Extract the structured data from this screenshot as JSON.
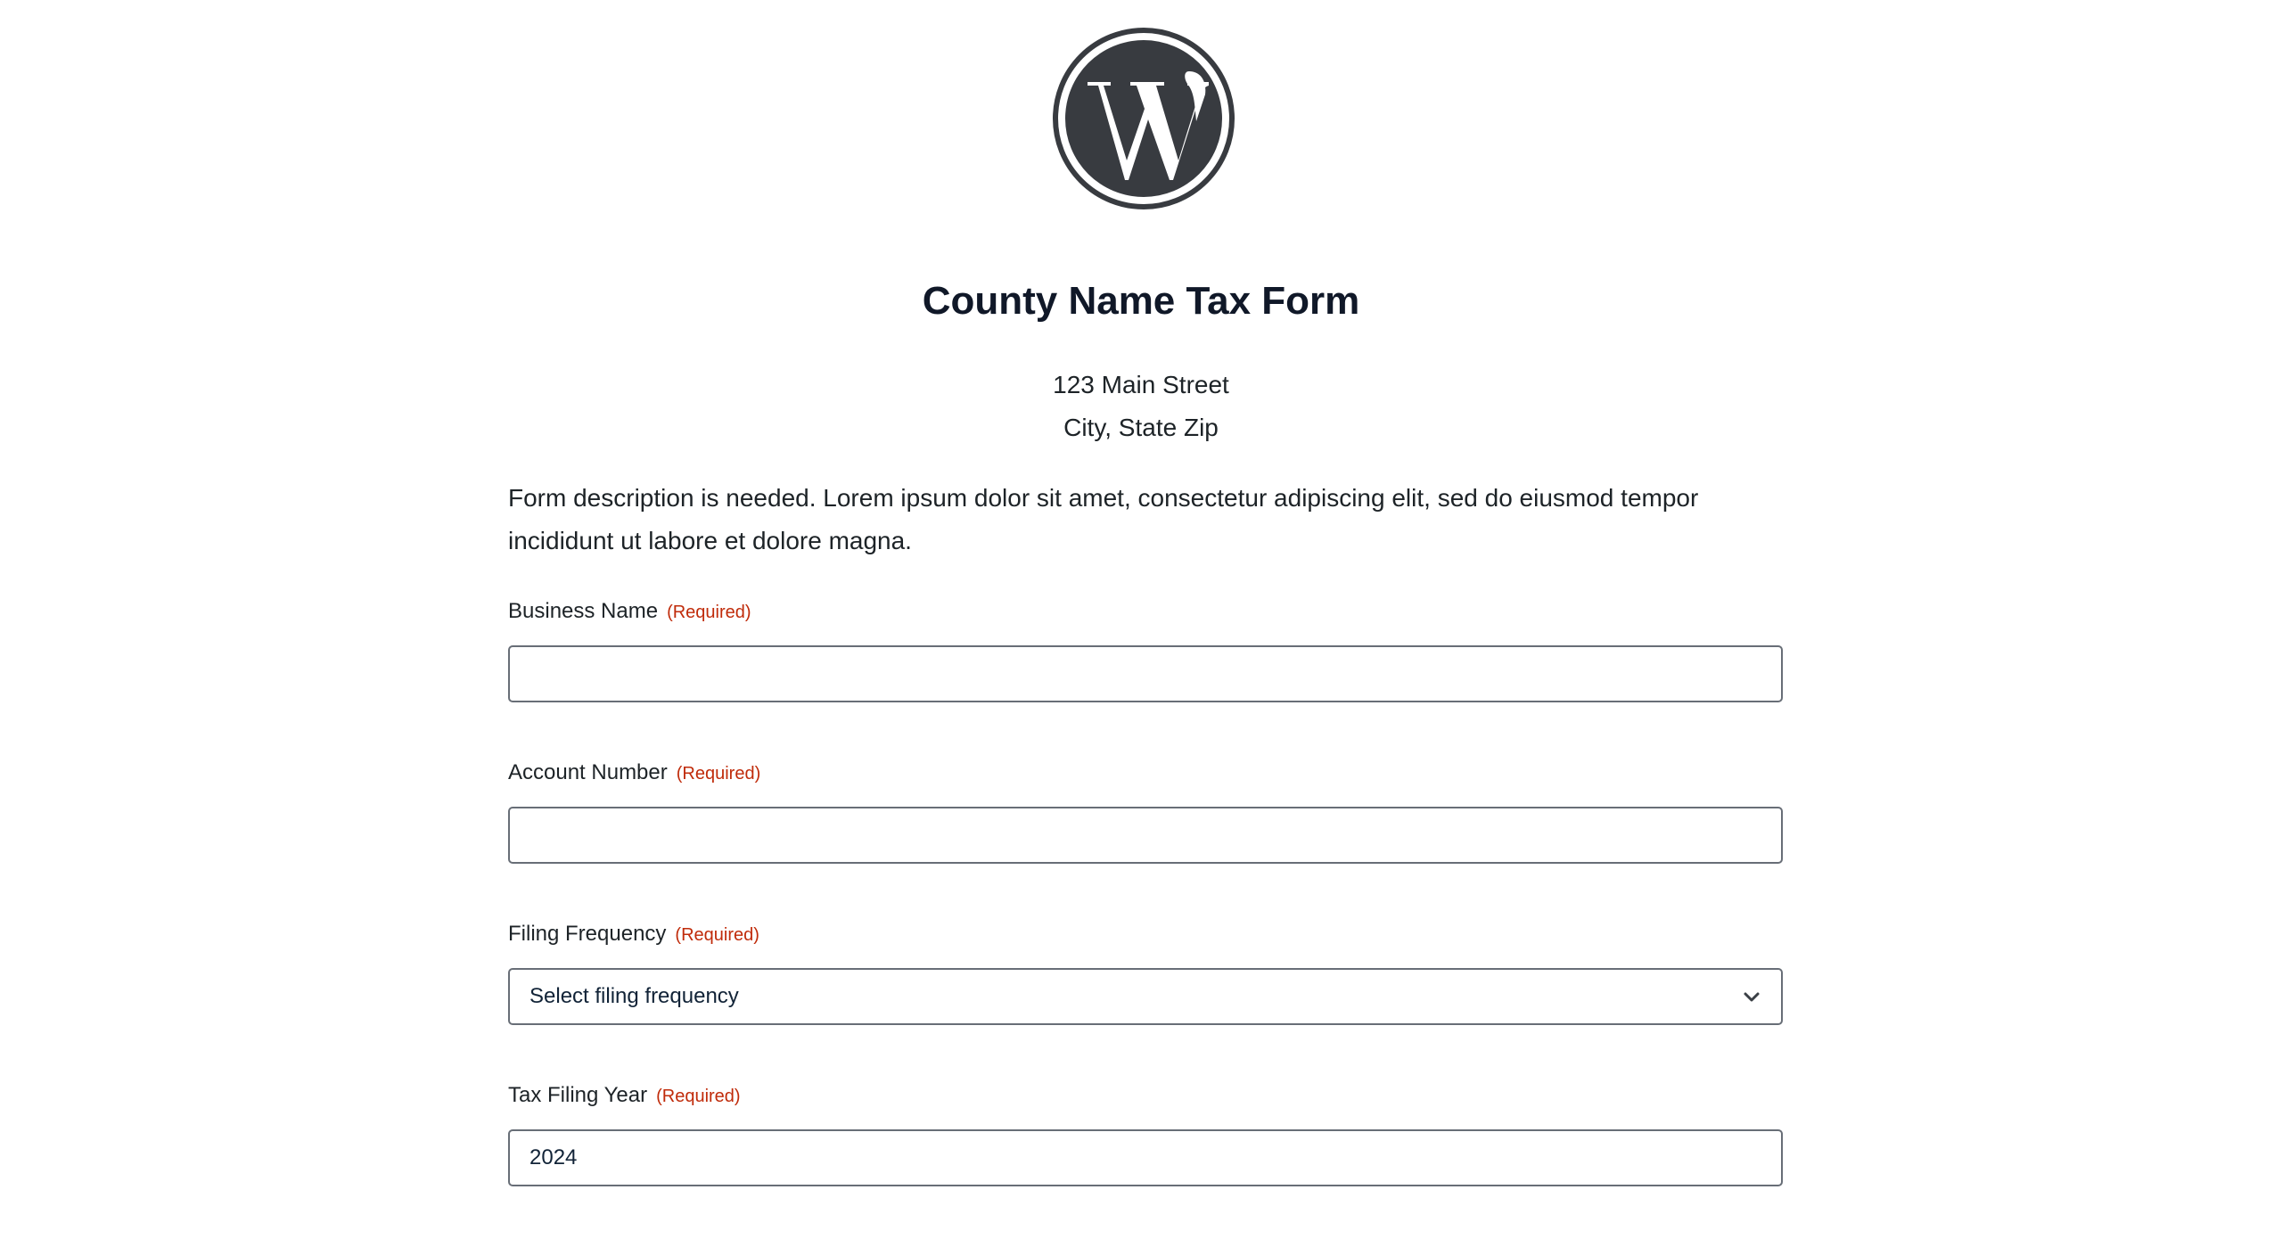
{
  "logo": {
    "icon": "wordpress-logo-icon",
    "color": "#383b40"
  },
  "header": {
    "title": "County Name Tax Form",
    "address_line1": "123 Main Street",
    "address_line2": "City, State Zip"
  },
  "form": {
    "description": "Form description is needed. Lorem ipsum dolor sit amet, consectetur adipiscing elit, sed do eiusmod tempor incididunt ut labore et dolore magna.",
    "required_text": "(Required)",
    "required_color": "#c02b0a",
    "fields": [
      {
        "label": "Business Name",
        "value": ""
      },
      {
        "label": "Account Number",
        "value": ""
      },
      {
        "label": "Filing Frequency",
        "value": "Select filing frequency",
        "icon": "chevron-down-icon"
      },
      {
        "label": "Tax Filing Year",
        "value": "2024"
      }
    ]
  }
}
